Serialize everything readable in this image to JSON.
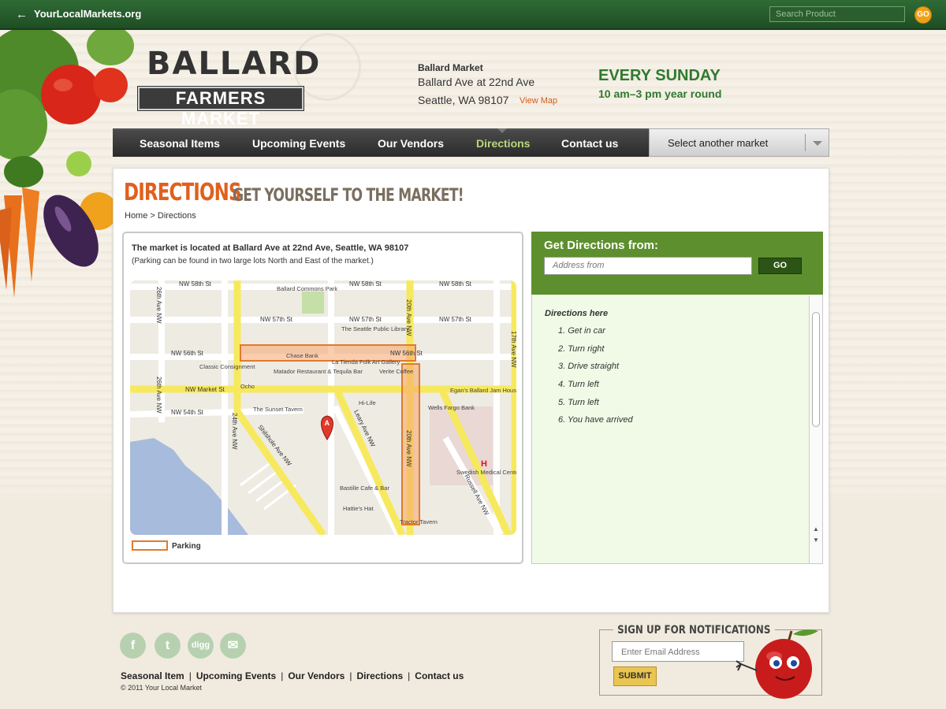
{
  "topbar": {
    "back_icon": "←",
    "site": "YourLocalMarkets.org",
    "search_placeholder": "Search Product",
    "go": "GO"
  },
  "header": {
    "logo_top": "BALLARD",
    "logo_bottom": "FARMERS MARKET",
    "market_name": "Ballard Market",
    "address_line1": "Ballard Ave at 22nd Ave",
    "address_line2": "Seattle, WA 98107",
    "view_map": "View Map",
    "schedule_title": "EVERY SUNDAY",
    "schedule_hours": "10 am–3 pm year round"
  },
  "nav": {
    "items": [
      {
        "label": "Seasonal Items"
      },
      {
        "label": "Upcoming Events"
      },
      {
        "label": "Our Vendors"
      },
      {
        "label": "Directions"
      },
      {
        "label": "Contact us"
      }
    ],
    "active_index": 3,
    "select_market": "Select another market"
  },
  "page": {
    "title": "DIRECTIONS",
    "subtitle": "GET YOURSELF TO THE MARKET!",
    "breadcrumb": "Home >  Directions"
  },
  "map_section": {
    "location_text": "The market is located at Ballard Ave at 22nd Ave, Seattle, WA 98107",
    "parking_text": "(Parking can be found in two large lots North and East of the market.)",
    "legend_label": "Parking",
    "streets": {
      "nw58": "NW 58th St",
      "nw57": "NW 57th St",
      "nw56": "NW 56th St",
      "nwmarket": "NW Market St",
      "nw54": "NW 54th St",
      "ave26": "26th Ave NW",
      "ave24": "24th Ave NW",
      "ave20": "20th Ave NW",
      "ave17": "17th Ave NW",
      "shilshole": "Shilshole Ave NW",
      "leary": "Leary Ave NW",
      "russell": "Russell Ave NW"
    },
    "places": {
      "commons": "Ballard Commons Park",
      "library": "The Seattle Public Library",
      "chase": "Chase Bank",
      "classic": "Classic Consignment",
      "matador": "Matador Restaurant & Tequila Bar",
      "tienda": "La Tienda Folk Art Gallery",
      "verite": "Verite Coffee",
      "ocho": "Ocho",
      "egans": "Egan's Ballard Jam House",
      "hilife": "Hi-Life",
      "wells": "Wells Fargo Bank",
      "sunset": "The Sunset Tavern",
      "swedish": "Swedish Medical Center-Ballard",
      "bastille": "Bastille Cafe & Bar",
      "hatties": "Hattie's Hat",
      "tractor": "Tractor Tavern",
      "marker": "A"
    }
  },
  "directions": {
    "header": "Get Directions from:",
    "address_placeholder": "Address from",
    "go": "GO",
    "list_title": "Directions here",
    "steps": [
      "1. Get in car",
      "2. Turn right",
      "3. Drive straight",
      "4. Turn left",
      "5. Turn left",
      "6. You have arrived"
    ]
  },
  "footer": {
    "social": [
      {
        "icon": "facebook-icon",
        "glyph": "f"
      },
      {
        "icon": "twitter-icon",
        "glyph": "t"
      },
      {
        "icon": "digg-icon",
        "glyph": "digg"
      },
      {
        "icon": "email-icon",
        "glyph": "✉"
      }
    ],
    "links": [
      "Seasonal Item",
      "Upcoming Events",
      "Our Vendors",
      "Directions",
      "Contact us"
    ],
    "copyright": "© 2011 Your Local Market",
    "signup_title": "SIGN UP FOR NOTIFICATIONS",
    "email_placeholder": "Enter Email Address",
    "submit": "SUBMIT"
  },
  "colors": {
    "brand_green": "#2f7a30",
    "accent_orange": "#e0601e",
    "nav_active": "#b8d87a",
    "parking": "#e37a2c"
  }
}
